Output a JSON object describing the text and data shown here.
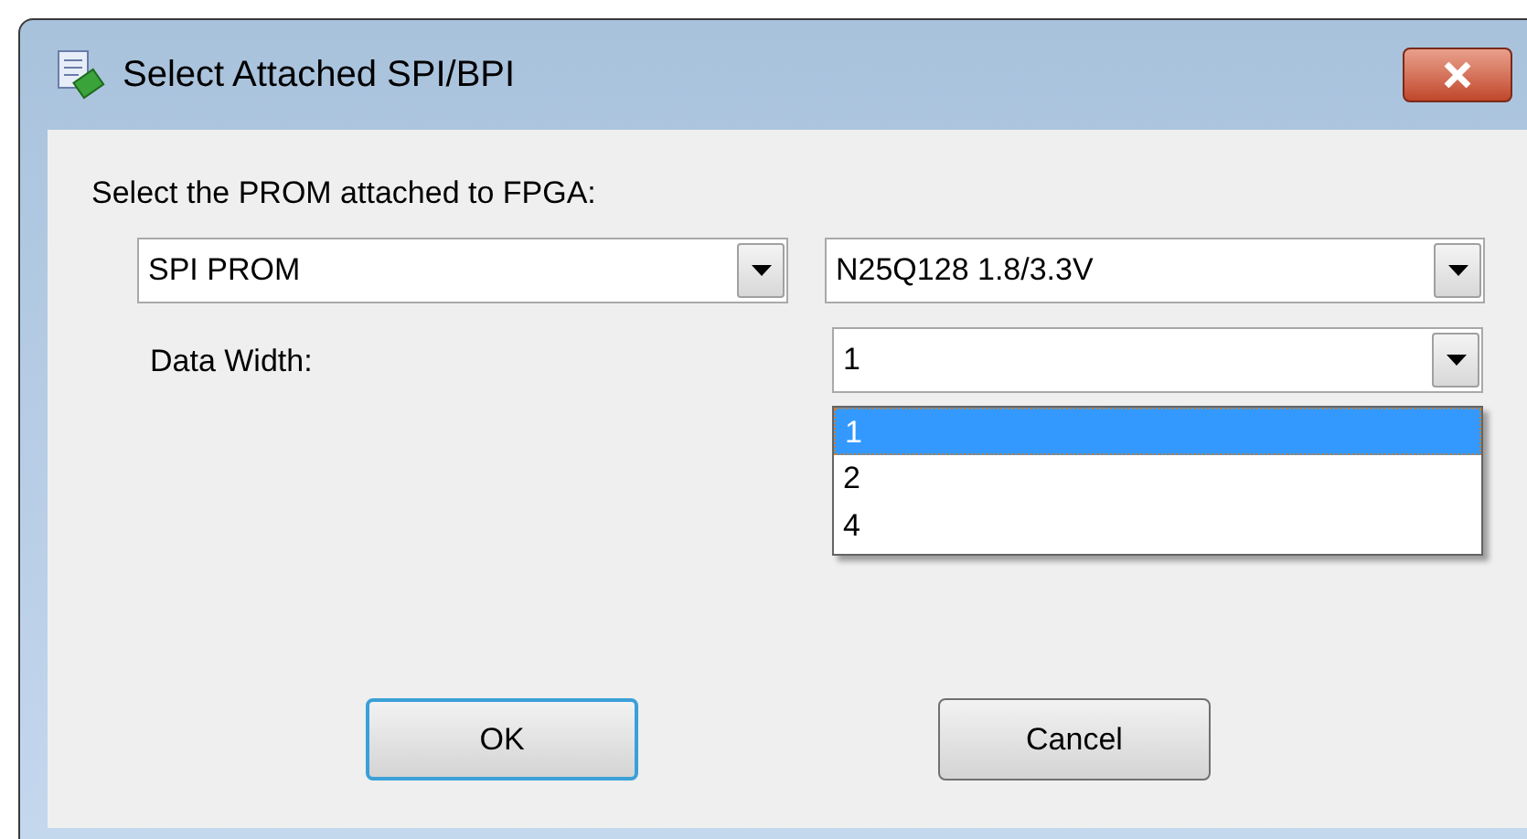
{
  "window": {
    "title": "Select Attached SPI/BPI"
  },
  "prom_label": "Select the PROM attached to FPGA:",
  "prom_type": {
    "value": "SPI PROM"
  },
  "prom_device": {
    "value": "N25Q128 1.8/3.3V"
  },
  "data_width": {
    "label": "Data Width:",
    "value": "1",
    "expanded": true,
    "options": [
      {
        "label": "1",
        "selected": true
      },
      {
        "label": "2",
        "selected": false
      },
      {
        "label": "4",
        "selected": false
      }
    ]
  },
  "buttons": [
    {
      "label": "OK",
      "kind": "default"
    },
    {
      "label": "Cancel",
      "kind": "normal"
    }
  ]
}
